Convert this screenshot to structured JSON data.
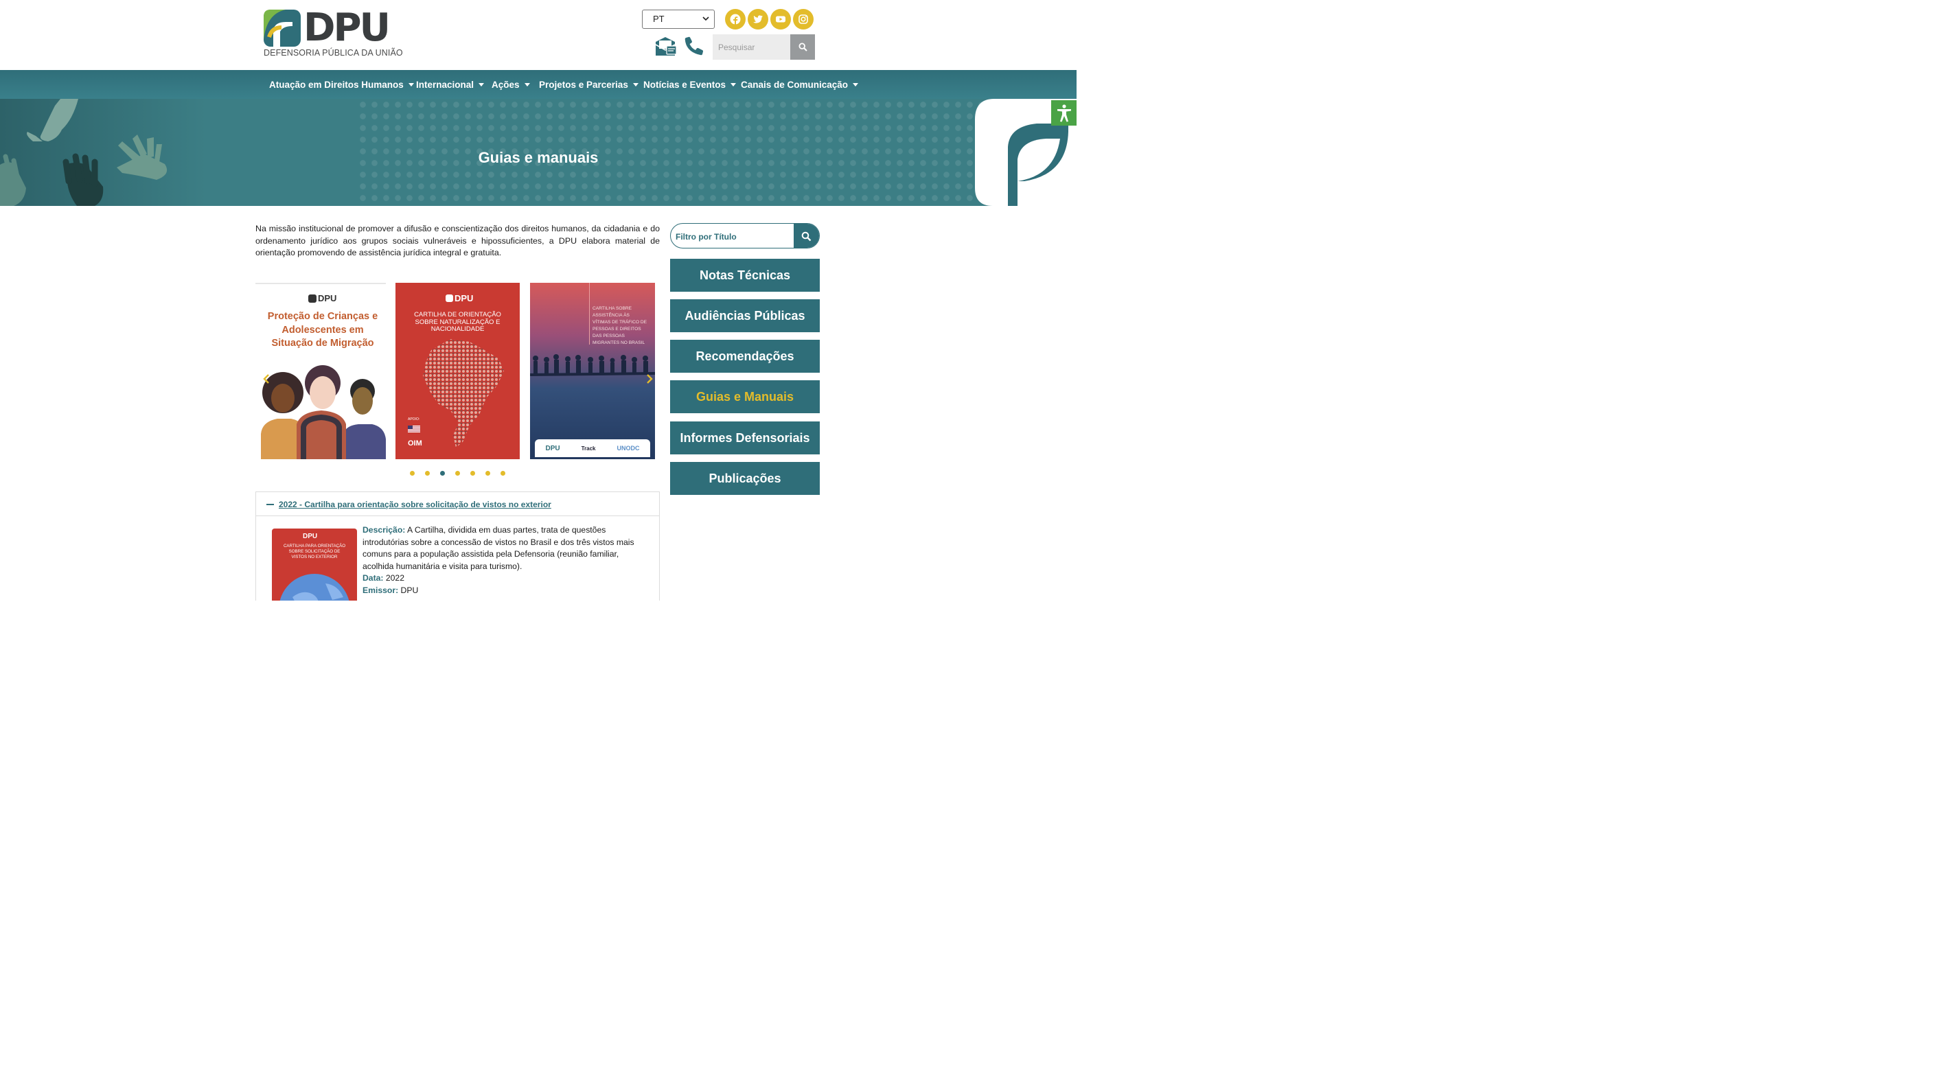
{
  "header": {
    "logo_text": "DPU",
    "logo_subtitle": "DEFENSORIA PÚBLICA DA UNIÃO",
    "language": {
      "selected": "PT"
    },
    "social_icons": [
      "facebook-icon",
      "twitter-icon",
      "youtube-icon",
      "instagram-icon"
    ],
    "search": {
      "placeholder": "Pesquisar"
    }
  },
  "nav": {
    "items": [
      {
        "label": "Atuação em Direitos Humanos"
      },
      {
        "label": "Internacional"
      },
      {
        "label": "Ações"
      },
      {
        "label": "Projetos e Parcerias"
      },
      {
        "label": "Notícias e Eventos"
      },
      {
        "label": "Canais de Comunicação"
      }
    ]
  },
  "hero": {
    "title": "Guias e manuais"
  },
  "intro": {
    "text": "Na missão institucional de promover a difusão e conscientização dos direitos humanos, da cidadania e do ordenamento jurídico aos grupos sociais vulneráveis e hipossuficientes, a DPU elabora material de orientação promovendo de assistência jurídica integral e gratuita."
  },
  "carousel": {
    "slides": [
      {
        "brand": "DPU",
        "title": "Proteção de Crianças e Adolescentes em Situação de Migração"
      },
      {
        "brand": "DPU",
        "title": "CARTILHA DE ORIENTAÇÃO SOBRE NATURALIZAÇÃO E NACIONALIDADE",
        "support_label": "APOIO:",
        "partner": "OIM"
      },
      {
        "title": "CARTILHA SOBRE ASSISTÊNCIA ÀS VÍTIMAS DE TRÁFICO DE PESSOAS E DIREITOS DAS PESSOAS MIGRANTES NO BRASIL",
        "partners": [
          "DPU",
          "Track",
          "UNODC"
        ]
      }
    ],
    "dot_count": 7,
    "active_dot": 3
  },
  "accordion": {
    "title": "2022 - Cartilha para orientação sobre solicitação de vistos no exterior",
    "cover": {
      "brand": "DPU",
      "title": "CARTILHA PARA ORIENTAÇÃO SOBRE SOLICITAÇÃO DE VISTOS NO EXTERIOR"
    },
    "description_label": "Descrição:",
    "description": "A Cartilha, dividida em duas partes, trata de questões introdutórias sobre a concessão de vistos no Brasil e dos três vistos mais comuns para a população assistida pela Defensoria (reunião familiar, acolhida humanitária e visita para turismo).",
    "date_label": "Data:",
    "date": "2022",
    "issuer_label": "Emissor:",
    "issuer": "DPU"
  },
  "sidebar": {
    "filter_placeholder": "Filtro por Título",
    "buttons": [
      {
        "label": "Notas Técnicas"
      },
      {
        "label": "Audiências Públicas"
      },
      {
        "label": "Recomendações"
      },
      {
        "label": "Guias e Manuais",
        "active": true
      },
      {
        "label": "Informes Defensoriais"
      },
      {
        "label": "Publicações"
      }
    ]
  },
  "colors": {
    "primary": "#2f6e79",
    "accent": "#e3bc2b",
    "accessibility": "#4aa346"
  }
}
